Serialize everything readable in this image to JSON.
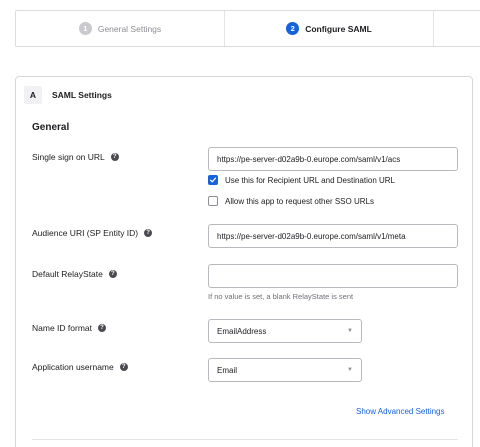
{
  "steps": [
    {
      "number": "1",
      "label": "General Settings"
    },
    {
      "number": "2",
      "label": "Configure SAML"
    }
  ],
  "card": {
    "badge": "A",
    "title": "SAML Settings",
    "section": "General"
  },
  "fields": {
    "sso_url": {
      "label": "Single sign on URL",
      "value": "https://pe-server-d02a9b-0.europe.com/saml/v1/acs"
    },
    "recipient_checkbox": {
      "label": "Use this for Recipient URL and Destination URL",
      "checked": true
    },
    "other_sso_checkbox": {
      "label": "Allow this app to request other SSO URLs",
      "checked": false
    },
    "audience_uri": {
      "label": "Audience URI (SP Entity ID)",
      "value": "https://pe-server-d02a9b-0.europe.com/saml/v1/meta"
    },
    "relay_state": {
      "label": "Default RelayState",
      "value": "",
      "hint": "If no value is set, a blank RelayState is sent"
    },
    "name_id_format": {
      "label": "Name ID format",
      "value": "EmailAddress"
    },
    "app_username": {
      "label": "Application username",
      "value": "Email"
    }
  },
  "advanced_link": "Show Advanced Settings",
  "colors": {
    "accent": "#1662dd",
    "muted": "#8d8d93"
  }
}
